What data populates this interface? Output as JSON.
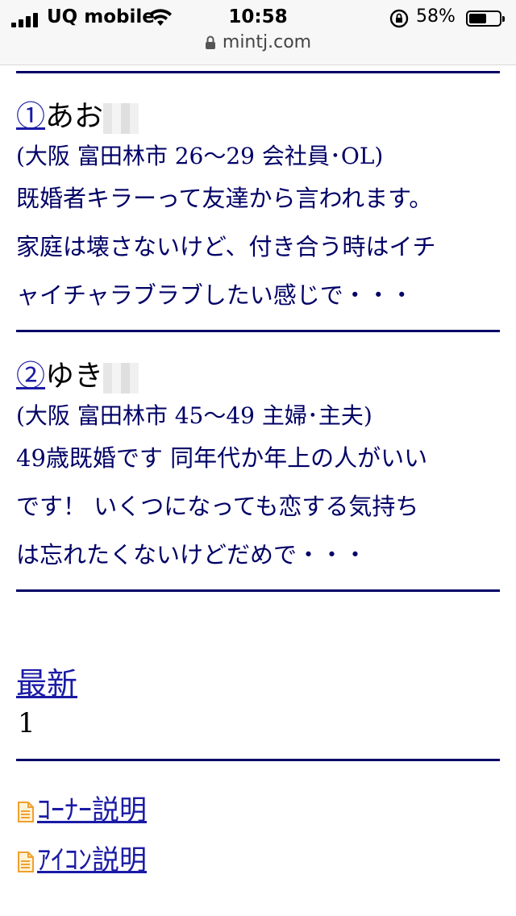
{
  "status_bar": {
    "carrier": "UQ mobile",
    "time": "10:58",
    "battery_percent": "58%",
    "battery_level": 0.58
  },
  "browser": {
    "url": "mintj.com"
  },
  "entries": [
    {
      "number": "①",
      "name": "あお",
      "profile": "(大阪 富田林市 26～29 会社員･OL)",
      "lines": [
        "既婚者キラーって友達から言われます。",
        "家庭は壊さないけど、付き合う時はイチ",
        "ャイチャラブラブしたい感じで・・・"
      ]
    },
    {
      "number": "②",
      "name": "ゆき",
      "profile": "(大阪 富田林市 45～49 主婦･主夫)",
      "lines": [
        "49歳既婚です 同年代か年上の人がいい",
        "です！ いくつになっても恋する気持ち",
        "は忘れたくないけどだめで・・・"
      ]
    }
  ],
  "pagination": {
    "latest_label": "最新",
    "page": "1"
  },
  "links": [
    {
      "label": "ｺｰﾅｰ説明",
      "icon": "document-icon"
    },
    {
      "label": "ｱｲｺﾝ説明",
      "icon": "document-icon"
    }
  ],
  "colors": {
    "accent": "#000066",
    "link": "#1a1aa6",
    "icon": "#f0a030"
  }
}
